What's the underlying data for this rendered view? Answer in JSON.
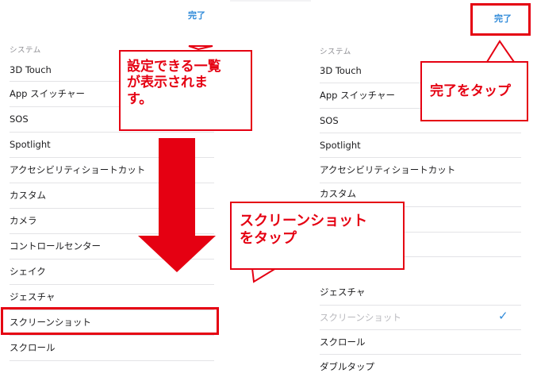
{
  "left_panel": {
    "done_label": "完了",
    "section_header": "システム",
    "items": [
      {
        "label": "3D Touch"
      },
      {
        "label": "App スイッチャー"
      },
      {
        "label": "SOS"
      },
      {
        "label": "Spotlight"
      },
      {
        "label": "アクセシビリティショートカット"
      },
      {
        "label": "カスタム"
      },
      {
        "label": "カメラ"
      },
      {
        "label": "コントロールセンター"
      },
      {
        "label": "シェイク"
      },
      {
        "label": "ジェスチャ"
      },
      {
        "label": "スクリーンショット"
      },
      {
        "label": "スクロール"
      }
    ]
  },
  "right_panel": {
    "done_label": "完了",
    "section_header": "システム",
    "items": [
      {
        "label": "3D Touch"
      },
      {
        "label": "App スイッチャー"
      },
      {
        "label": "SOS"
      },
      {
        "label": "Spotlight"
      },
      {
        "label": "アクセシビリティショートカット"
      },
      {
        "label": "カスタム"
      },
      {
        "label": "ジェスチャ"
      },
      {
        "label": "スクリーンショット"
      },
      {
        "label": "スクロール"
      },
      {
        "label": "ダブルタップ"
      }
    ]
  },
  "annotations": {
    "callout_list": [
      "設定できる一覧",
      "が表示されま",
      "す。"
    ],
    "callout_done": "完了をタップ",
    "callout_screenshot": [
      "スクリーンショット",
      "をタップ"
    ],
    "accent_color": "#e50012",
    "link_color": "#2f8ad9",
    "checkmark_icon": "✓"
  }
}
